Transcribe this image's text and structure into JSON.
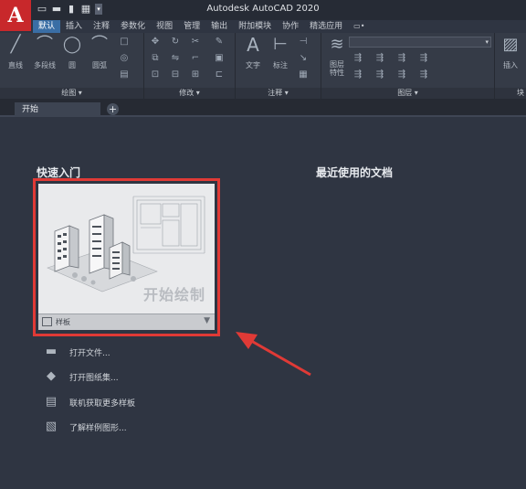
{
  "app": {
    "title": "Autodesk AutoCAD 2020",
    "logo_letter": "A"
  },
  "qat_icons": [
    "new-file-icon",
    "open-folder-icon",
    "save-icon",
    "print-icon"
  ],
  "ribbon": {
    "tabs": [
      "默认",
      "插入",
      "注释",
      "参数化",
      "视图",
      "管理",
      "输出",
      "附加模块",
      "协作",
      "精选应用",
      "▭•"
    ],
    "active_tab": "默认",
    "panels": {
      "draw": {
        "label": "绘图 ▾",
        "tools": [
          "直线",
          "多段线",
          "圆",
          "圆弧"
        ]
      },
      "modify": {
        "label": "修改 ▾"
      },
      "annotation": {
        "label": "注释 ▾",
        "tools": [
          "文字",
          "标注"
        ]
      },
      "layers": {
        "label": "图层 ▾",
        "tools": [
          "图层\n特性"
        ]
      },
      "insert": {
        "label": "块",
        "tools": [
          "插入"
        ]
      }
    }
  },
  "doc_tabs": {
    "start_tab": "开始",
    "add_symbol": "+"
  },
  "start_page": {
    "quick_start_title": "快速入门",
    "recent_docs_title": "最近使用的文档",
    "start_drawing_label": "开始绘制",
    "template_label": "样板",
    "template_caret": "▼",
    "links": [
      {
        "label": "打开文件...",
        "icon": "open-folder-icon"
      },
      {
        "label": "打开图纸集...",
        "icon": "sheet-set-icon"
      },
      {
        "label": "联机获取更多样板",
        "icon": "online-templates-icon"
      },
      {
        "label": "了解样例图形...",
        "icon": "sample-drawings-icon"
      }
    ]
  },
  "colors": {
    "highlight_box": "#e03a36",
    "accent_tab": "#3a6ea5",
    "background": "#2f3542"
  }
}
